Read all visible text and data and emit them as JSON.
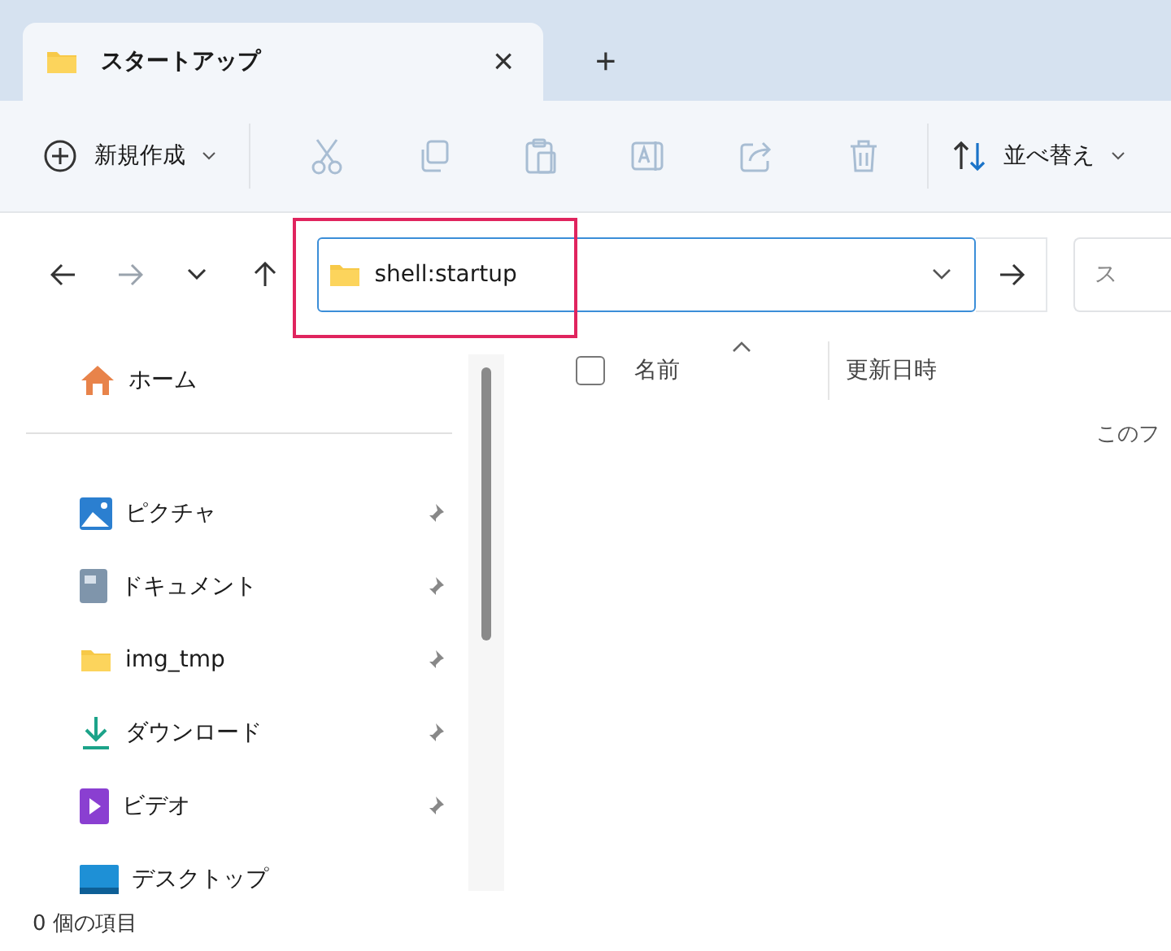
{
  "tab": {
    "title": "スタートアップ",
    "close": "×",
    "new_tab": "+"
  },
  "toolbar": {
    "items": [
      {
        "kind": "new",
        "label": "新規作成",
        "disabled": false
      },
      {
        "kind": "cut",
        "disabled": true
      },
      {
        "kind": "copy",
        "disabled": true
      },
      {
        "kind": "paste",
        "disabled": true
      },
      {
        "kind": "rename",
        "disabled": true
      },
      {
        "kind": "share",
        "disabled": true
      },
      {
        "kind": "delete",
        "disabled": true
      },
      {
        "kind": "sort",
        "label": "並べ替え",
        "disabled": false
      }
    ]
  },
  "navigation": [
    {
      "kind": "back",
      "disabled": false
    },
    {
      "kind": "forward",
      "disabled": true
    },
    {
      "kind": "recent",
      "disabled": false
    },
    {
      "kind": "up",
      "disabled": false
    }
  ],
  "address_bar": {
    "value": "shell:startup",
    "highlighted": true
  },
  "search": {
    "placeholder": "ス"
  },
  "sidebar": {
    "items": [
      {
        "kind": "home",
        "label": "ホーム",
        "pinned": false
      },
      {
        "kind": "pictures",
        "label": "ピクチャ",
        "pinned": true
      },
      {
        "kind": "documents",
        "label": "ドキュメント",
        "pinned": true
      },
      {
        "kind": "folder",
        "label": "img_tmp",
        "pinned": true
      },
      {
        "kind": "download",
        "label": "ダウンロード",
        "pinned": true
      },
      {
        "kind": "video",
        "label": "ビデオ",
        "pinned": true
      },
      {
        "kind": "desktop",
        "label": "デスクトップ",
        "pinned": false
      }
    ]
  },
  "file_list": {
    "select_all_checked": false,
    "columns": [
      {
        "label": "名前",
        "sorted": true
      },
      {
        "label": "更新日時",
        "sorted": false
      }
    ],
    "empty_message": "このフ"
  },
  "status_bar": "0 個の項目"
}
